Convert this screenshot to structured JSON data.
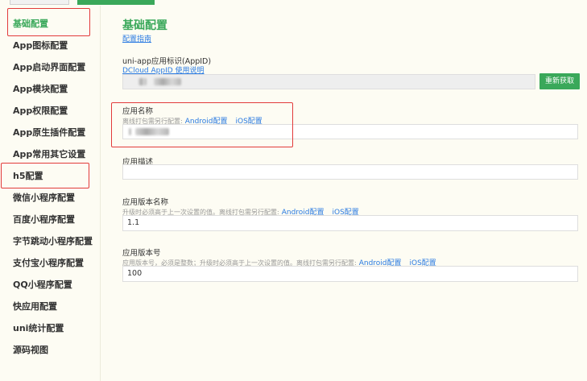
{
  "sidebar": {
    "items": [
      {
        "label": "基础配置",
        "active": true
      },
      {
        "label": "App图标配置"
      },
      {
        "label": "App启动界面配置"
      },
      {
        "label": "App模块配置"
      },
      {
        "label": "App权限配置"
      },
      {
        "label": "App原生插件配置"
      },
      {
        "label": "App常用其它设置"
      },
      {
        "label": "h5配置"
      },
      {
        "label": "微信小程序配置"
      },
      {
        "label": "百度小程序配置"
      },
      {
        "label": "字节跳动小程序配置"
      },
      {
        "label": "支付宝小程序配置"
      },
      {
        "label": "QQ小程序配置"
      },
      {
        "label": "快应用配置"
      },
      {
        "label": "uni统计配置"
      },
      {
        "label": "源码视图"
      }
    ]
  },
  "main": {
    "title": "基础配置",
    "guide_link": "配置指南",
    "appid": {
      "label": "uni-app应用标识(AppID)",
      "link": "DCloud AppID 使用说明",
      "button": "重新获取"
    },
    "app_name": {
      "label": "应用名称",
      "hint": "离线打包需另行配置:",
      "android_link": "Android配置",
      "ios_link": "iOS配置"
    },
    "app_desc": {
      "label": "应用描述",
      "value": ""
    },
    "version_name": {
      "label": "应用版本名称",
      "hint": "升级时必须高于上一次设置的值。离线打包需另行配置:",
      "android_link": "Android配置",
      "ios_link": "iOS配置",
      "value": "1.1"
    },
    "version_code": {
      "label": "应用版本号",
      "hint": "应用版本号，必须是整数；升级时必须高于上一次设置的值。离线打包需另行配置:",
      "android_link": "Android配置",
      "ios_link": "iOS配置",
      "value": "100"
    }
  },
  "colors": {
    "accent": "#3aa85a",
    "link": "#2a7ae2",
    "highlight": "#e23b3b"
  }
}
